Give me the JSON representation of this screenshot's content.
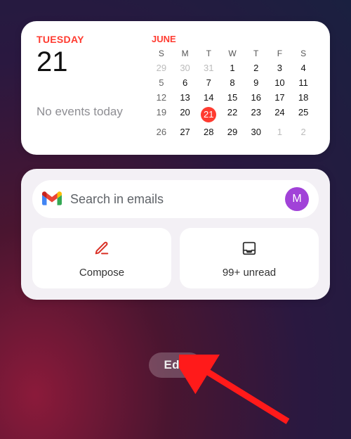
{
  "calendar": {
    "day_name": "TUESDAY",
    "day_number": "21",
    "events_text": "No events today",
    "month_name": "JUNE",
    "dow": [
      "S",
      "M",
      "T",
      "W",
      "T",
      "F",
      "S"
    ],
    "weeks": [
      [
        {
          "d": "29",
          "cls": "other"
        },
        {
          "d": "30",
          "cls": "other"
        },
        {
          "d": "31",
          "cls": "other"
        },
        {
          "d": "1"
        },
        {
          "d": "2"
        },
        {
          "d": "3"
        },
        {
          "d": "4"
        }
      ],
      [
        {
          "d": "5",
          "cls": "sun"
        },
        {
          "d": "6"
        },
        {
          "d": "7"
        },
        {
          "d": "8"
        },
        {
          "d": "9"
        },
        {
          "d": "10"
        },
        {
          "d": "11"
        }
      ],
      [
        {
          "d": "12",
          "cls": "sun"
        },
        {
          "d": "13"
        },
        {
          "d": "14"
        },
        {
          "d": "15"
        },
        {
          "d": "16"
        },
        {
          "d": "17"
        },
        {
          "d": "18"
        }
      ],
      [
        {
          "d": "19",
          "cls": "sun"
        },
        {
          "d": "20"
        },
        {
          "d": "21",
          "cls": "today"
        },
        {
          "d": "22"
        },
        {
          "d": "23"
        },
        {
          "d": "24"
        },
        {
          "d": "25"
        }
      ],
      [
        {
          "d": "26",
          "cls": "sun"
        },
        {
          "d": "27"
        },
        {
          "d": "28"
        },
        {
          "d": "29"
        },
        {
          "d": "30"
        },
        {
          "d": "1",
          "cls": "other"
        },
        {
          "d": "2",
          "cls": "other"
        }
      ]
    ]
  },
  "gmail": {
    "search_placeholder": "Search in emails",
    "avatar_initial": "M",
    "compose_label": "Compose",
    "inbox_label": "99+ unread"
  },
  "edit_label": "Edit",
  "colors": {
    "accent_red": "#ff3b30",
    "avatar": "#a142d8"
  }
}
